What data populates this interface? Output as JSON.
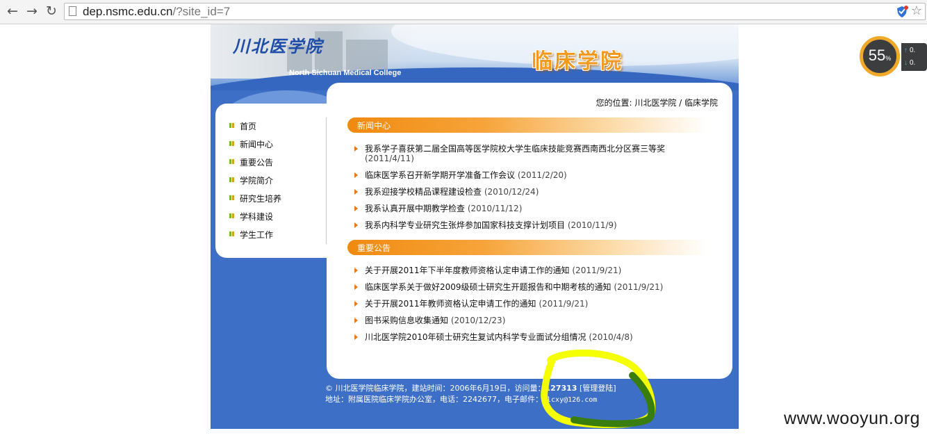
{
  "browser": {
    "url_host": "dep.nsmc.edu.cn",
    "url_path": "/?site_id=7"
  },
  "site": {
    "logo_cn": "川北医学院",
    "logo_en": "North Sichuan Medical College",
    "college_name": "临床学院",
    "breadcrumb": "您的位置: 川北医学院 / 临床学院"
  },
  "nav": [
    {
      "label": "首页"
    },
    {
      "label": "新闻中心"
    },
    {
      "label": "重要公告"
    },
    {
      "label": "学院简介"
    },
    {
      "label": "研究生培养"
    },
    {
      "label": "学科建设"
    },
    {
      "label": "学生工作"
    }
  ],
  "news": {
    "title": "新闻中心",
    "items": [
      {
        "text": "我系学子喜获第二届全国高等医学院校大学生临床技能竞赛西南西北分区赛三等奖",
        "date": "(2011/4/11)"
      },
      {
        "text": "临床医学系召开新学期开学准备工作会议",
        "date": "(2011/2/20)"
      },
      {
        "text": "我系迎接学校精品课程建设检查",
        "date": "(2010/12/24)"
      },
      {
        "text": "我系认真开展中期教学检查",
        "date": "(2010/11/12)"
      },
      {
        "text": "我系内科学专业研究生张烨参加国家科技支撑计划项目",
        "date": "(2010/11/9)"
      }
    ]
  },
  "notices": {
    "title": "重要公告",
    "items": [
      {
        "text": "关于开展2011年下半年度教师资格认定申请工作的通知",
        "date": "(2011/9/21)"
      },
      {
        "text": "临床医学系关于做好2009级硕士研究生开题报告和中期考核的通知",
        "date": "(2011/9/21)"
      },
      {
        "text": "关于开展2011年教师资格认定申请工作的通知",
        "date": "(2011/9/21)"
      },
      {
        "text": "图书采购信息收集通知",
        "date": "(2010/12/23)"
      },
      {
        "text": "川北医学院2010年硕士研究生复试内科学专业面试分组情况",
        "date": "(2010/4/8)"
      }
    ]
  },
  "footer": {
    "copyright": "© 川北医学院临床学院，建站时间：2006年6月19日，访问量：",
    "visit_count": "127313",
    "admin_link": "[管理登陆]",
    "address": "地址：附属医院临床学院办公室，电话：2242677，电子邮件：",
    "email": "flcxy@126.com"
  },
  "widget": {
    "percent": "55",
    "percent_unit": "%",
    "up": "0.",
    "down": "0."
  },
  "watermark": "www.wooyun.org",
  "colors": {
    "site_blue": "#3d6fc6",
    "accent_orange": "#f08a10",
    "annotation_yellow": "#f5ff00",
    "annotation_green": "#3a7d0f"
  }
}
